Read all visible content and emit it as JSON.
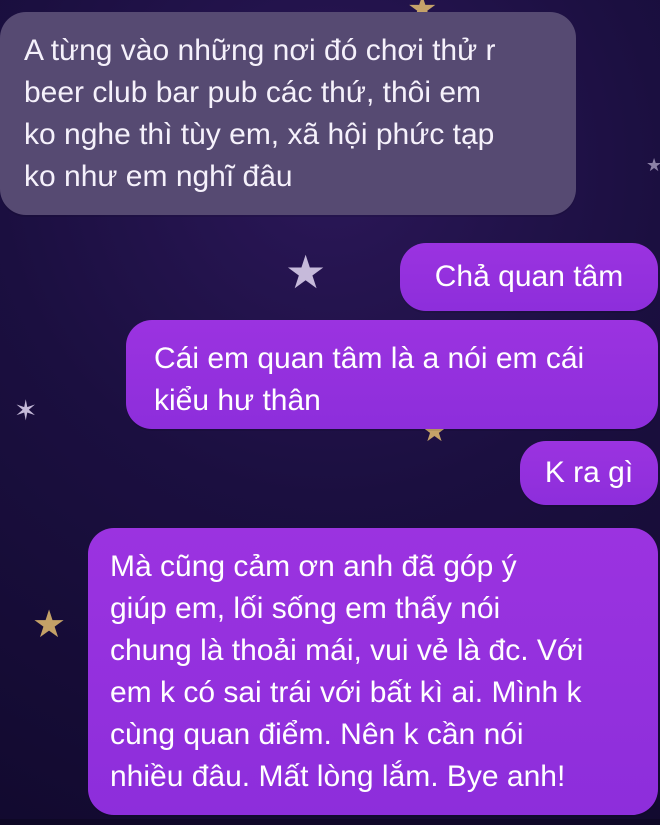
{
  "theme": {
    "background": "#1b0f40",
    "incoming_bubble": "#564a72",
    "outgoing_bubble": "#8d2edb",
    "text": "#ffffff"
  },
  "decor": {
    "icons": [
      "star-icon",
      "star-icon",
      "star-icon",
      "sparkle-icon",
      "star-icon",
      "star-icon"
    ]
  },
  "messages": [
    {
      "sender": "them",
      "text": "A từng vào những nơi đó chơi thử r\nbeer club bar pub các thứ, thôi em\nko nghe thì tùy em, xã hội phức tạp\nko như em nghĩ đâu"
    },
    {
      "sender": "me",
      "text": "Chả quan tâm"
    },
    {
      "sender": "me",
      "text": "Cái em quan tâm là a nói em cái\nkiểu hư thân"
    },
    {
      "sender": "me",
      "text": "K ra gì"
    },
    {
      "sender": "me",
      "text": "Mà cũng cảm ơn anh đã góp ý\ngiúp em, lối sống em thấy nói\nchung là thoải mái, vui vẻ là đc. Với\nem k có sai trái với bất kì ai. Mình k\ncùng quan điểm. Nên k cần nói\nnhiều đâu. Mất lòng lắm. Bye anh!"
    }
  ]
}
